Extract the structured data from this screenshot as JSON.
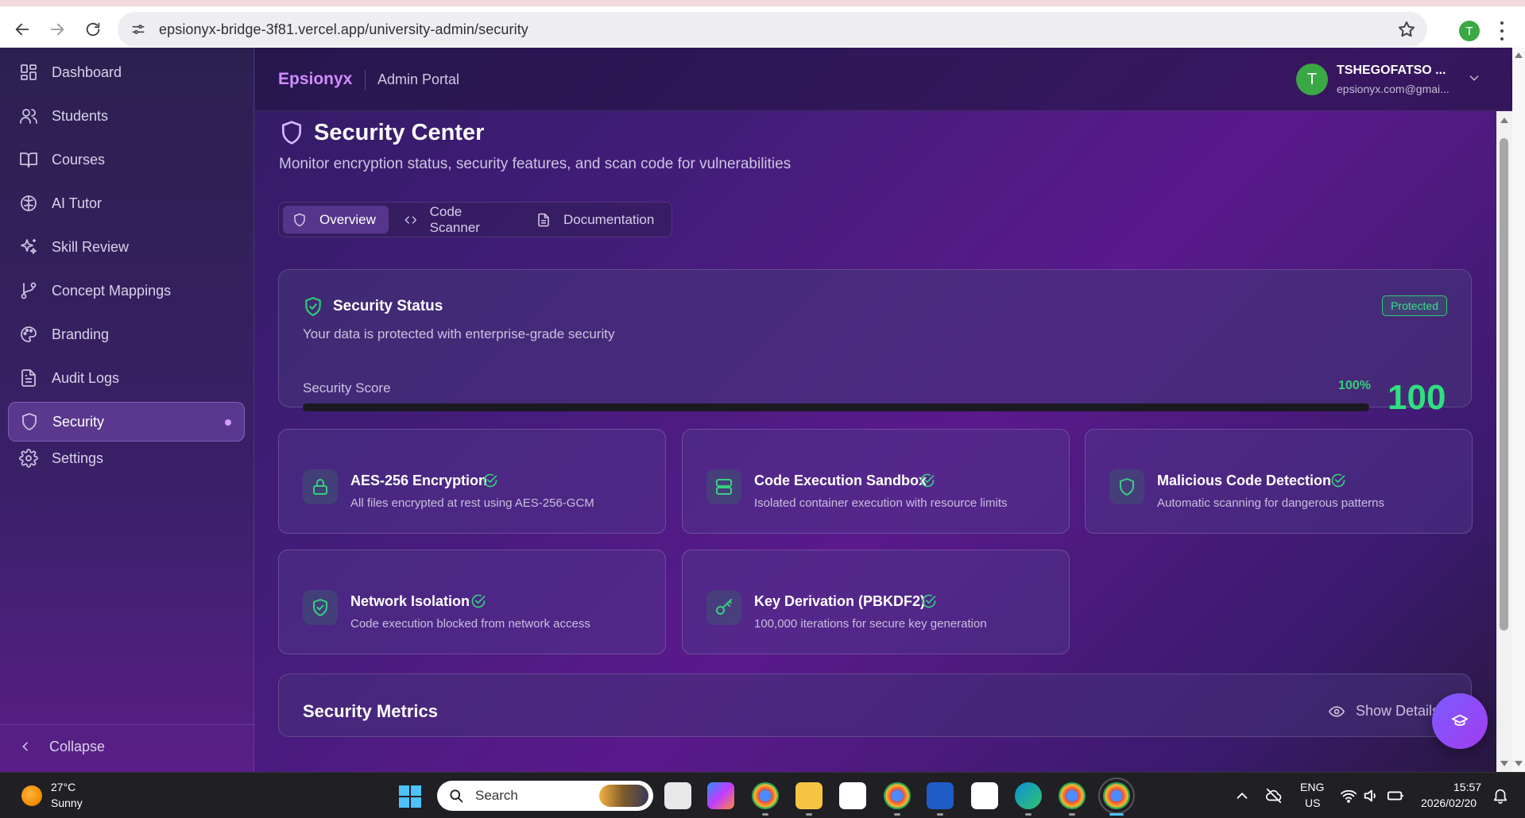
{
  "browser": {
    "url": "epsionyx-bridge-3f81.vercel.app/university-admin/security",
    "profile_initial": "T"
  },
  "header": {
    "brand": "Epsionyx",
    "portal": "Admin Portal",
    "user_initial": "T",
    "user_name": "TSHEGOFATSO ...",
    "user_email": "epsionyx.com@gmai..."
  },
  "sidebar": {
    "items": [
      {
        "label": "Dashboard",
        "icon": "dashboard-icon"
      },
      {
        "label": "Students",
        "icon": "users-icon"
      },
      {
        "label": "Courses",
        "icon": "book-icon"
      },
      {
        "label": "AI Tutor",
        "icon": "brain-icon"
      },
      {
        "label": "Skill Review",
        "icon": "sparkles-icon"
      },
      {
        "label": "Concept Mappings",
        "icon": "git-branch-icon"
      },
      {
        "label": "Branding",
        "icon": "palette-icon"
      },
      {
        "label": "Audit Logs",
        "icon": "file-text-icon"
      },
      {
        "label": "Security",
        "icon": "shield-icon",
        "active": true
      },
      {
        "label": "Settings",
        "icon": "gear-icon"
      }
    ],
    "collapse_label": "Collapse"
  },
  "page": {
    "title": "Security Center",
    "subtitle": "Monitor encryption status, security features, and scan code for vulnerabilities",
    "tabs": [
      {
        "label": "Overview",
        "icon": "shield-icon",
        "active": true
      },
      {
        "label": "Code Scanner",
        "icon": "code-icon"
      },
      {
        "label": "Documentation",
        "icon": "file-icon"
      }
    ]
  },
  "security_status": {
    "title": "Security Status",
    "description": "Your data is protected with enterprise-grade security",
    "badge": "Protected",
    "score_label": "Security Score",
    "score_percent": "100%",
    "score_value": "100",
    "score_fraction": 1.0
  },
  "features": [
    {
      "title": "AES-256 Encryption",
      "description": "All files encrypted at rest using AES-256-GCM",
      "icon": "lock-icon",
      "status": "check-icon"
    },
    {
      "title": "Code Execution Sandbox",
      "description": "Isolated container execution with resource limits",
      "icon": "server-icon",
      "status": "check-icon"
    },
    {
      "title": "Malicious Code Detection",
      "description": "Automatic scanning for dangerous patterns",
      "icon": "shield-icon",
      "status": "check-icon"
    },
    {
      "title": "Network Isolation",
      "description": "Code execution blocked from network access",
      "icon": "shield-check-icon",
      "status": "check-icon"
    },
    {
      "title": "Key Derivation (PBKDF2)",
      "description": "100,000 iterations for secure key generation",
      "icon": "key-icon",
      "status": "check-icon"
    }
  ],
  "metrics": {
    "title": "Security Metrics",
    "toggle_label": "Show Details"
  },
  "taskbar": {
    "weather_temp": "27°C",
    "weather_cond": "Sunny",
    "search_placeholder": "Search",
    "lang_line1": "ENG",
    "lang_line2": "US",
    "time": "15:57",
    "date": "2026/02/20"
  },
  "colors": {
    "accent_purple": "#d18cff",
    "success_green": "#2fe07e",
    "active_nav": "#a06ee6"
  }
}
